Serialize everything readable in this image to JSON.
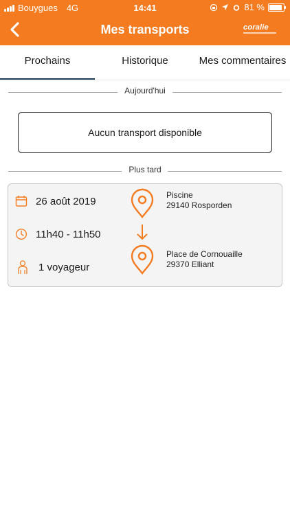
{
  "status_bar": {
    "carrier": "Bouygues",
    "network": "4G",
    "time": "14:41",
    "battery": "81 %",
    "battery_level": 0.81
  },
  "header": {
    "title": "Mes transports",
    "logo_text": "coralie",
    "back_icon": "chevron-left-icon"
  },
  "tabs": [
    {
      "label": "Prochains",
      "active": true
    },
    {
      "label": "Historique",
      "active": false
    },
    {
      "label": "Mes commentaires",
      "active": false
    }
  ],
  "sections": {
    "today_label": "Aujourd'hui",
    "today_empty": "Aucun transport disponible",
    "later_label": "Plus tard"
  },
  "transport": {
    "date": "26 août 2019",
    "time_range": "11h40 - 11h50",
    "travelers": "1 voyageur",
    "origin": {
      "name": "Piscine",
      "city": "29140 Rosporden"
    },
    "destination": {
      "name": "Place de Cornouaille",
      "city": "29370 Elliant"
    }
  },
  "colors": {
    "accent": "#f47b20",
    "tab_indicator": "#1f3c5a",
    "card_bg": "#f4f4f4"
  }
}
